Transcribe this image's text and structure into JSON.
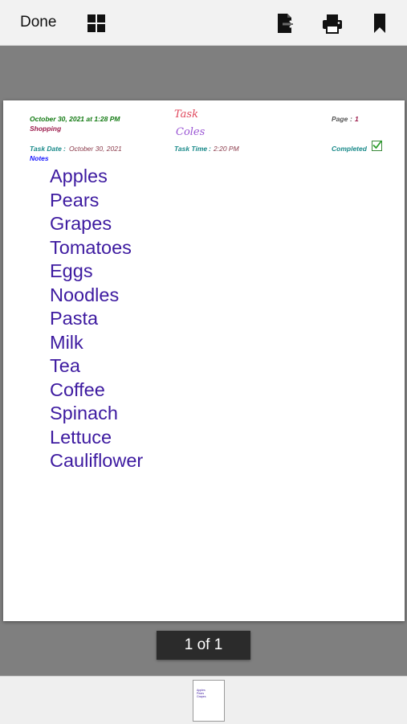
{
  "toolbar": {
    "done_label": "Done",
    "icons": [
      "thumbnail-grid-icon",
      "export-icon",
      "print-icon",
      "bookmark-icon"
    ]
  },
  "document": {
    "header": {
      "datetime": "October 30, 2021 at 1:28 PM",
      "category": "Shopping",
      "title_script": "Task",
      "subtitle_script": "Coles",
      "page_label": "Page",
      "page_sep": ":",
      "page_number": "1",
      "task_date_label": "Task Date",
      "task_date_sep": ":",
      "task_date_value": "October 30, 2021",
      "task_time_label": "Task Time",
      "task_time_sep": ":",
      "task_time_value": "2:20 PM",
      "completed_label": "Completed",
      "completed": true,
      "notes_label": "Notes"
    },
    "notes": [
      "Apples",
      "Pears",
      "Grapes",
      "Tomatoes",
      "Eggs",
      "Noodles",
      "Pasta",
      "Milk",
      "Tea",
      "Coffee",
      "Spinach",
      "Lettuce",
      "Cauliflower"
    ]
  },
  "pager": {
    "label": "1 of 1"
  },
  "thumbnail": {
    "lines": [
      "Apples",
      "Pears",
      "Grapes"
    ]
  },
  "colors": {
    "date_green": "#137a13",
    "category_maroon": "#9c1c4c",
    "script_red": "#e0455a",
    "script_purple": "#9a55d4",
    "label_teal": "#1a8a8a",
    "value_maroon": "#8a3a4a",
    "notes_blue": "#1a1aff",
    "list_purple": "#3d1aa0"
  }
}
